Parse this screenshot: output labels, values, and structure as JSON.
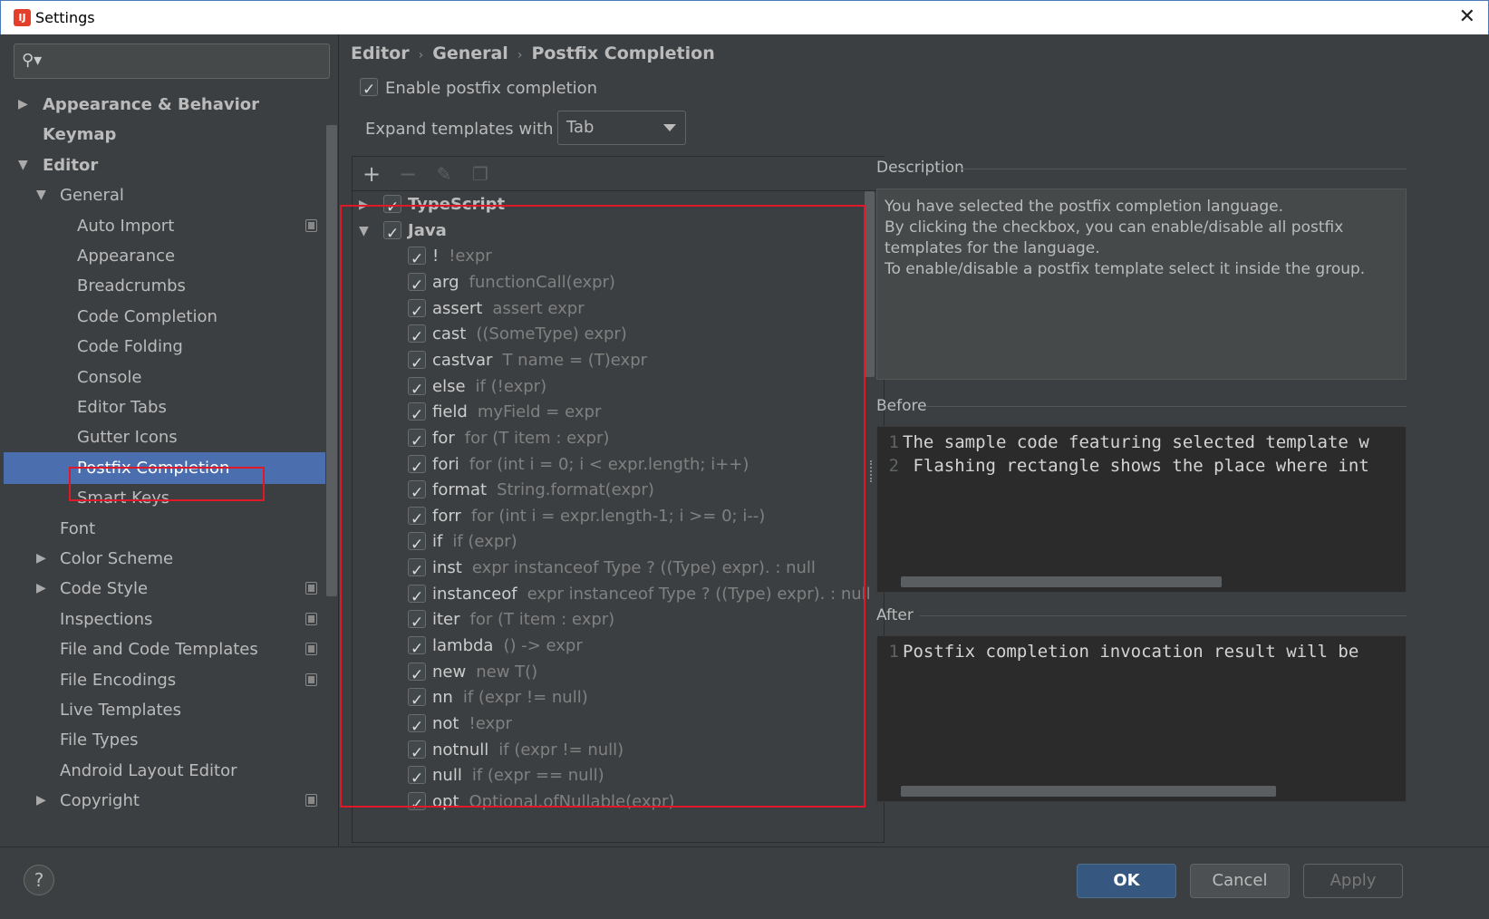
{
  "window": {
    "title": "Settings",
    "app_icon": "IJ",
    "close": "✕"
  },
  "search": {
    "placeholder": ""
  },
  "tree": [
    {
      "label": "Appearance & Behavior",
      "arrow": "▶",
      "bold": true,
      "level": 0
    },
    {
      "label": "Keymap",
      "arrow": "",
      "bold": true,
      "level": 0
    },
    {
      "label": "Editor",
      "arrow": "▼",
      "bold": true,
      "level": 0
    },
    {
      "label": "General",
      "arrow": "▼",
      "bold": false,
      "level": 1
    },
    {
      "label": "Auto Import",
      "arrow": "",
      "bold": false,
      "level": 2,
      "project": true
    },
    {
      "label": "Appearance",
      "arrow": "",
      "bold": false,
      "level": 2
    },
    {
      "label": "Breadcrumbs",
      "arrow": "",
      "bold": false,
      "level": 2
    },
    {
      "label": "Code Completion",
      "arrow": "",
      "bold": false,
      "level": 2
    },
    {
      "label": "Code Folding",
      "arrow": "",
      "bold": false,
      "level": 2
    },
    {
      "label": "Console",
      "arrow": "",
      "bold": false,
      "level": 2
    },
    {
      "label": "Editor Tabs",
      "arrow": "",
      "bold": false,
      "level": 2
    },
    {
      "label": "Gutter Icons",
      "arrow": "",
      "bold": false,
      "level": 2
    },
    {
      "label": "Postfix Completion",
      "arrow": "",
      "bold": false,
      "level": 2,
      "selected": true
    },
    {
      "label": "Smart Keys",
      "arrow": "",
      "bold": false,
      "level": 2
    },
    {
      "label": "Font",
      "arrow": "",
      "bold": false,
      "level": 1
    },
    {
      "label": "Color Scheme",
      "arrow": "▶",
      "bold": false,
      "level": 1
    },
    {
      "label": "Code Style",
      "arrow": "▶",
      "bold": false,
      "level": 1,
      "project": true
    },
    {
      "label": "Inspections",
      "arrow": "",
      "bold": false,
      "level": 1,
      "project": true
    },
    {
      "label": "File and Code Templates",
      "arrow": "",
      "bold": false,
      "level": 1,
      "project": true
    },
    {
      "label": "File Encodings",
      "arrow": "",
      "bold": false,
      "level": 1,
      "project": true
    },
    {
      "label": "Live Templates",
      "arrow": "",
      "bold": false,
      "level": 1
    },
    {
      "label": "File Types",
      "arrow": "",
      "bold": false,
      "level": 1
    },
    {
      "label": "Android Layout Editor",
      "arrow": "",
      "bold": false,
      "level": 1
    },
    {
      "label": "Copyright",
      "arrow": "▶",
      "bold": false,
      "level": 1,
      "project": true
    }
  ],
  "breadcrumb": [
    "Editor",
    "General",
    "Postfix Completion"
  ],
  "breadcrumb_sep": "›",
  "enable": {
    "label": "Enable postfix completion",
    "checked": true
  },
  "expand": {
    "label": "Expand templates with",
    "value": "Tab"
  },
  "toolbar": {
    "add": "+",
    "remove": "−",
    "edit": "✎",
    "copy": "❐"
  },
  "languages": [
    {
      "name": "TypeScript",
      "arrow": "▶",
      "checked": true
    },
    {
      "name": "Java",
      "arrow": "▼",
      "checked": true
    }
  ],
  "templates": [
    {
      "key": "!",
      "example": "!expr"
    },
    {
      "key": "arg",
      "example": "functionCall(expr)"
    },
    {
      "key": "assert",
      "example": "assert expr"
    },
    {
      "key": "cast",
      "example": "((SomeType) expr)"
    },
    {
      "key": "castvar",
      "example": "T name = (T)expr"
    },
    {
      "key": "else",
      "example": "if (!expr)"
    },
    {
      "key": "field",
      "example": "myField = expr"
    },
    {
      "key": "for",
      "example": "for (T item : expr)"
    },
    {
      "key": "fori",
      "example": "for (int i = 0; i < expr.length; i++)"
    },
    {
      "key": "format",
      "example": "String.format(expr)"
    },
    {
      "key": "forr",
      "example": "for (int i = expr.length-1; i >= 0; i--)"
    },
    {
      "key": "if",
      "example": "if (expr)"
    },
    {
      "key": "inst",
      "example": "expr instanceof Type ? ((Type) expr). : null"
    },
    {
      "key": "instanceof",
      "example": "expr instanceof Type ? ((Type) expr). : null"
    },
    {
      "key": "iter",
      "example": "for (T item : expr)"
    },
    {
      "key": "lambda",
      "example": "() -> expr"
    },
    {
      "key": "new",
      "example": "new T()"
    },
    {
      "key": "nn",
      "example": "if (expr != null)"
    },
    {
      "key": "not",
      "example": "!expr"
    },
    {
      "key": "notnull",
      "example": "if (expr != null)"
    },
    {
      "key": "null",
      "example": "if (expr == null)"
    },
    {
      "key": "opt",
      "example": "Optional.ofNullable(expr)"
    }
  ],
  "description": {
    "title": "Description",
    "lines": [
      "You have selected the postfix completion language.",
      "By clicking the checkbox, you can enable/disable all postfix templates for the language.",
      "To enable/disable a postfix template select it inside the group."
    ]
  },
  "before": {
    "title": "Before",
    "lines": [
      {
        "num": "1",
        "text": "The sample code featuring selected template w"
      },
      {
        "num": "2",
        "text": " Flashing rectangle shows the place where int"
      }
    ]
  },
  "after": {
    "title": "After",
    "lines": [
      {
        "num": "1",
        "text": "Postfix completion invocation result will be"
      }
    ]
  },
  "buttons": {
    "help": "?",
    "ok": "OK",
    "cancel": "Cancel",
    "apply": "Apply"
  },
  "colors": {
    "selection": "#4b6eaf",
    "highlight": "#e0192a",
    "ok": "#365880"
  }
}
